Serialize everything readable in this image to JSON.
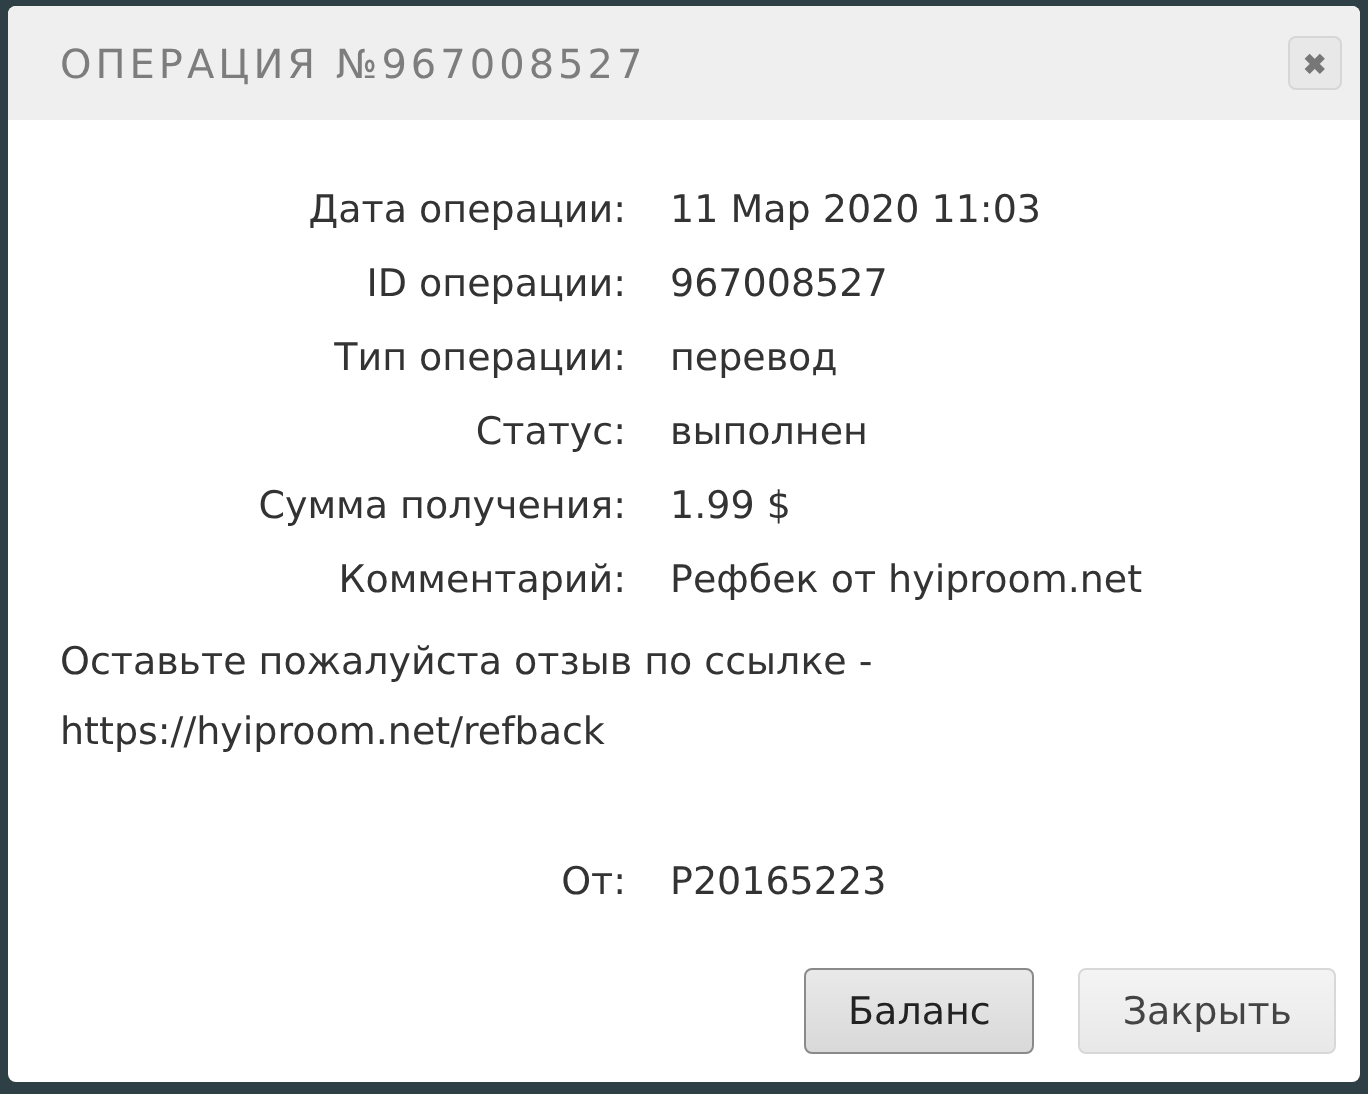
{
  "dialog": {
    "title": "ОПЕРАЦИЯ №967008527",
    "close_icon": "✖"
  },
  "details": [
    {
      "label": "Дата операции:",
      "value": "11 Мар 2020 11:03"
    },
    {
      "label": "ID операции:",
      "value": "967008527"
    },
    {
      "label": "Тип операции:",
      "value": "перевод"
    },
    {
      "label": "Статус:",
      "value": "выполнен"
    },
    {
      "label": "Сумма получения:",
      "value": "1.99 $"
    },
    {
      "label": "Комментарий:",
      "value": "Рефбек от hyiproom.net"
    }
  ],
  "comment_text": "Оставьте пожалуйста отзыв по ссылке - https://hyiproom.net/refback",
  "sender": {
    "label": "От:",
    "value": "P20165223"
  },
  "buttons": [
    {
      "label": "Баланс",
      "focused": true
    },
    {
      "label": "Закрыть",
      "focused": false
    }
  ]
}
